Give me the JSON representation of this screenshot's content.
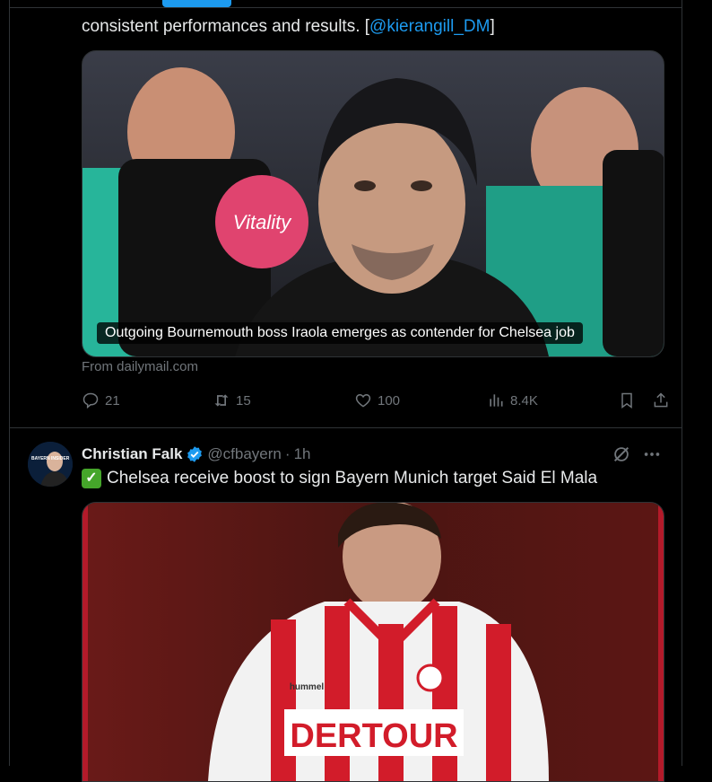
{
  "tweet1": {
    "text_prefix": "consistent performances and results. [",
    "mention": "@kierangill_DM",
    "text_suffix": "]",
    "card": {
      "caption": "Outgoing Bournemouth boss Iraola emerges as contender for Chelsea job",
      "sponsor_text": "Vitality",
      "source": "From dailymail.com"
    },
    "actions": {
      "replies": "21",
      "reposts": "15",
      "likes": "100",
      "views": "8.4K"
    }
  },
  "tweet2": {
    "display_name": "Christian Falk",
    "handle": "@cfbayern",
    "separator": "·",
    "time": "1h",
    "text": "Chelsea receive boost to sign Bayern Munich target Said El Mala",
    "avatar_text": "BAYERN INSIDER",
    "image": {
      "shirt_text": "DERTOUR",
      "brand_text": "hummel"
    }
  },
  "colors": {
    "accent": "#1d9bf0",
    "muted": "#71767b",
    "border": "#2f3336",
    "verified": "#1d9bf0"
  },
  "icons": [
    "reply-icon",
    "repost-icon",
    "like-icon",
    "views-icon",
    "bookmark-icon",
    "share-icon",
    "verified-icon",
    "grok-icon",
    "more-icon",
    "check-emoji-icon"
  ]
}
